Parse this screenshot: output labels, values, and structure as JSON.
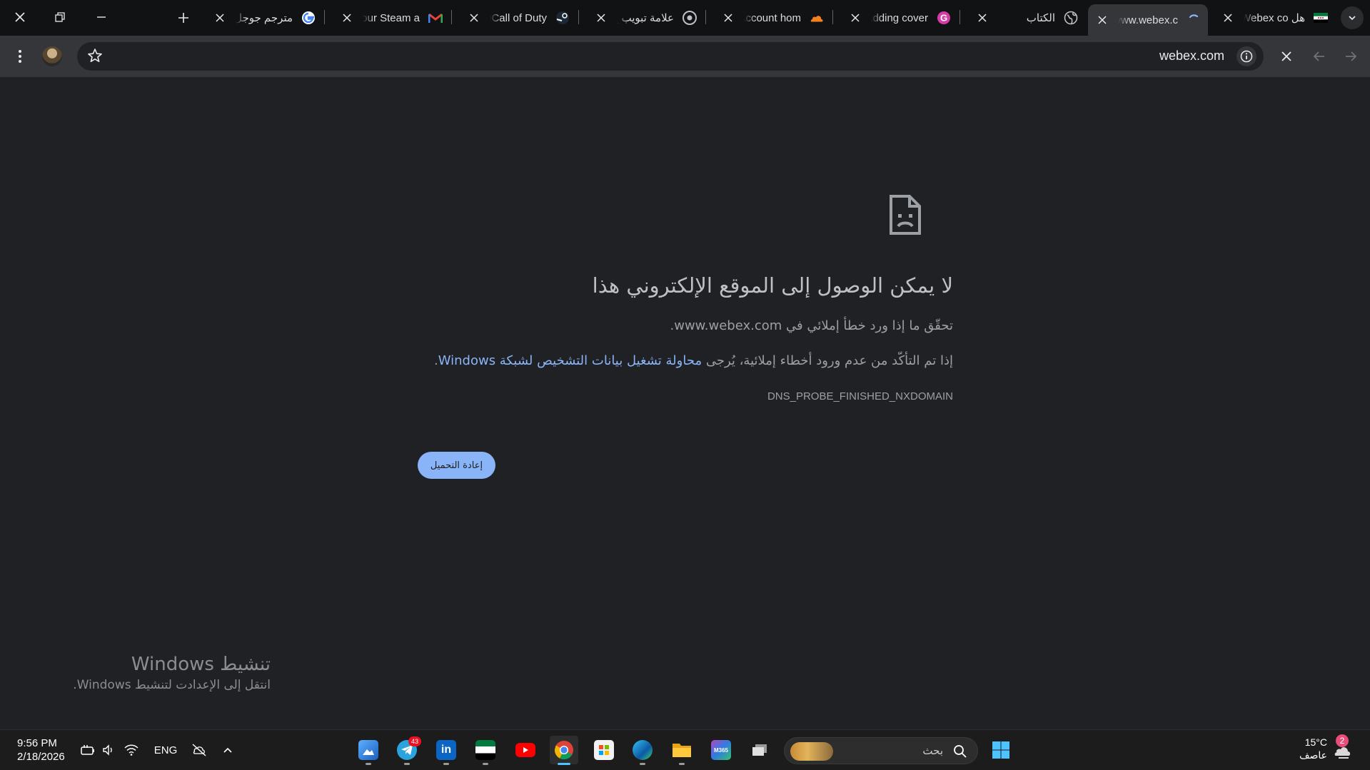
{
  "tabs": [
    {
      "title": "هل Webex co",
      "favicon": "flag-icon"
    },
    {
      "title": "www.webex.c",
      "favicon": "loading-icon",
      "active": true
    },
    {
      "title": "الكتاب",
      "favicon": "globe-icon"
    },
    {
      "title": "Adding cover",
      "favicon": "g-logo-icon"
    },
    {
      "title": "Account hom",
      "favicon": "cloud-icon"
    },
    {
      "title": "علامة تبويب ج",
      "favicon": "chrome-icon"
    },
    {
      "title": "Call of Duty®",
      "favicon": "steam-icon"
    },
    {
      "title": "Your Steam a",
      "favicon": "gmail-icon"
    },
    {
      "title": "مترجم جوجل -",
      "favicon": "google-icon"
    }
  ],
  "toolbar": {
    "url": "webex.com"
  },
  "error": {
    "title": "لا يمكن الوصول إلى الموقع الإلكتروني هذا",
    "line1": "تحقّق ما إذا ورد خطأ إملائي في www.webex.com.",
    "line2_prefix": "إذا تم التأكّد من عدم ورود أخطاء إملائية، يُرجى",
    "line2_link": "محاولة تشغيل بيانات التشخيص لشبكة Windows",
    "line2_suffix": ".",
    "code": "DNS_PROBE_FINISHED_NXDOMAIN",
    "reload_label": "إعادة التحميل"
  },
  "watermark": {
    "title": "تنشيط Windows",
    "subtitle": "انتقل إلى الإعدادت لتنشيط Windows."
  },
  "taskbar": {
    "time": "9:56 PM",
    "date": "2/18/2026",
    "language": "ENG",
    "search_placeholder": "بحث",
    "telegram_badge": "43",
    "weather_temp": "15°C",
    "weather_desc": "عاصف",
    "notification_count": "2"
  },
  "colors": {
    "page_bg": "#202124",
    "link": "#8ab4f8",
    "button_bg": "#8ab4f8",
    "tabstrip_bg": "#111214",
    "toolbar_bg": "#35363a"
  }
}
